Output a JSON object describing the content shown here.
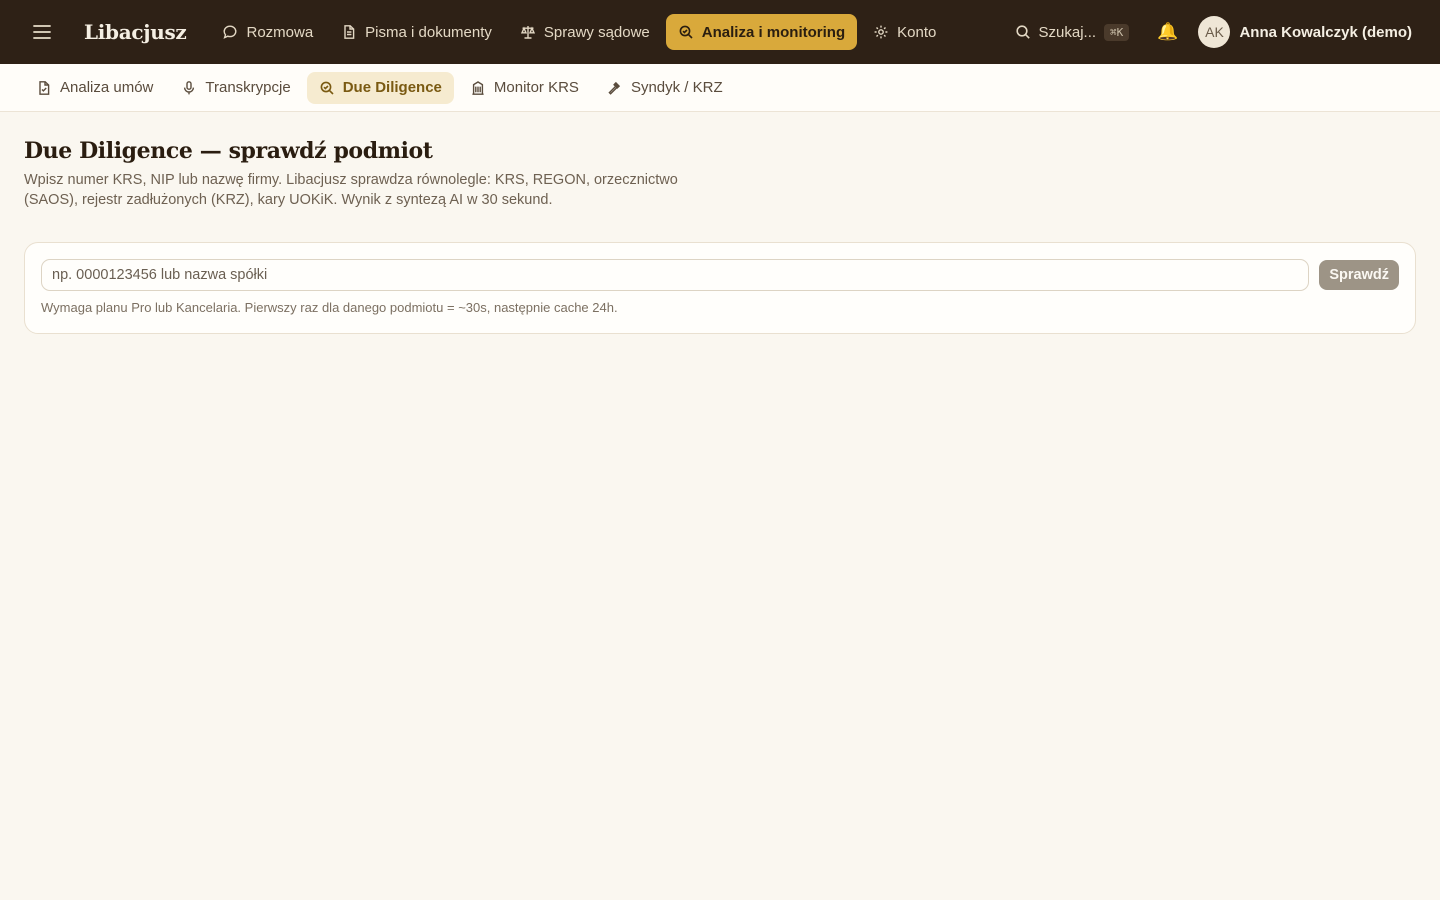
{
  "app": {
    "brand": "Libacjusz"
  },
  "nav": {
    "items": [
      {
        "label": "Rozmowa",
        "icon": "chat-bubble-icon"
      },
      {
        "label": "Pisma i dokumenty",
        "icon": "document-icon"
      },
      {
        "label": "Sprawy sądowe",
        "icon": "scales-icon"
      },
      {
        "label": "Analiza i monitoring",
        "icon": "magnifier-icon",
        "active": true
      },
      {
        "label": "Konto",
        "icon": "gear-icon"
      }
    ]
  },
  "search": {
    "label": "Szukaj...",
    "shortcut": "⌘K"
  },
  "user": {
    "initials": "AK",
    "name": "Anna Kowalczyk (demo)"
  },
  "subnav": {
    "items": [
      {
        "label": "Analiza umów",
        "icon": "document-check-icon"
      },
      {
        "label": "Transkrypcje",
        "icon": "microphone-icon"
      },
      {
        "label": "Due Diligence",
        "icon": "magnifier-icon",
        "active": true
      },
      {
        "label": "Monitor KRS",
        "icon": "building-icon"
      },
      {
        "label": "Syndyk / KRZ",
        "icon": "gavel-icon"
      }
    ]
  },
  "page": {
    "title": "Due Diligence — sprawdź podmiot",
    "description": "Wpisz numer KRS, NIP lub nazwę firmy. Libacjusz sprawdza równolegle: KRS, REGON, orzecznictwo (SAOS), rejestr zadłużonych (KRZ), kary UOKiK. Wynik z syntezą AI w 30 sekund."
  },
  "form": {
    "placeholder": "np. 0000123456 lub nazwa spółki",
    "value": "",
    "button": "Sprawdź",
    "hint": "Wymaga planu Pro lub Kancelaria. Pierwszy raz dla danego podmiotu = ~30s, następnie cache 24h."
  },
  "colors": {
    "topbar": "#2e2116",
    "accent": "#d9a93b",
    "background": "#faf7f0",
    "button_disabled": "#9d9486"
  }
}
